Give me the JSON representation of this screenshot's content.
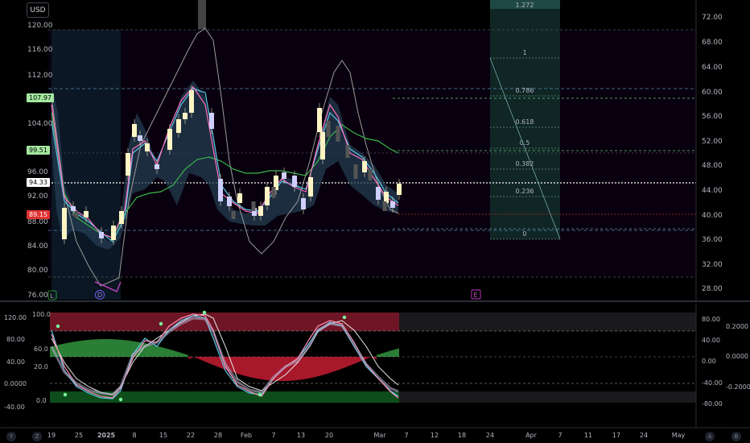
{
  "currency_button": "USD",
  "left_axis": [
    "120.00",
    "116.00",
    "112.00",
    "104.00",
    "96.00",
    "92.00",
    "88.00",
    "84.00",
    "80.00",
    "76.00"
  ],
  "price_tags": {
    "high": {
      "label": "107.97",
      "color": "#a5e8a0"
    },
    "mid": {
      "label": "99.51",
      "color": "#a5e8a0"
    },
    "last": {
      "label": "94.33",
      "color": "#ffffff"
    },
    "low": {
      "label": "89.15",
      "color": "#e03131"
    }
  },
  "right_axis": [
    "72.00",
    "68.00",
    "64.00",
    "60.00",
    "56.00",
    "52.00",
    "48.00",
    "44.00",
    "40.00",
    "36.00",
    "32.00",
    "28.00"
  ],
  "fib_levels": [
    "1.272",
    "1",
    "0.786",
    "0.618",
    "0.5",
    "0.382",
    "0.236",
    "0"
  ],
  "markers": {
    "d": "D",
    "e": "E",
    "l": "L"
  },
  "osc_left_axis": [
    "120.00",
    "100.0",
    "80.00",
    "60.0",
    "40.00",
    "20.0",
    "0.0000",
    "0.0",
    "-40.00"
  ],
  "osc_right_axis_a": [
    "80.00",
    "40.00",
    "0.00",
    "-40.00",
    "-80.00"
  ],
  "osc_right_axis_b": [
    "0.2000",
    "0.0000",
    "-0.2000"
  ],
  "time_axis": [
    "19",
    "25",
    "2025",
    "8",
    "15",
    "22",
    "28",
    "Feb",
    "7",
    "13",
    "20",
    "Mar",
    "7",
    "12",
    "18",
    "24",
    "Apr",
    "7",
    "11",
    "17",
    "24",
    "May"
  ],
  "bottom_buttons": {
    "left_y": "Y",
    "left_z": "Z",
    "right_a": "A",
    "right_b": "B"
  },
  "colors": {
    "bull": "#fff5c4",
    "bear": "#cfcfff",
    "ma_green": "#3cb44b",
    "ma_pink": "#ff70c0",
    "ma_blue": "#5bc8e8",
    "band": "#2b4a66",
    "ob": "#8a1c2e",
    "os": "#0f5a20"
  }
}
